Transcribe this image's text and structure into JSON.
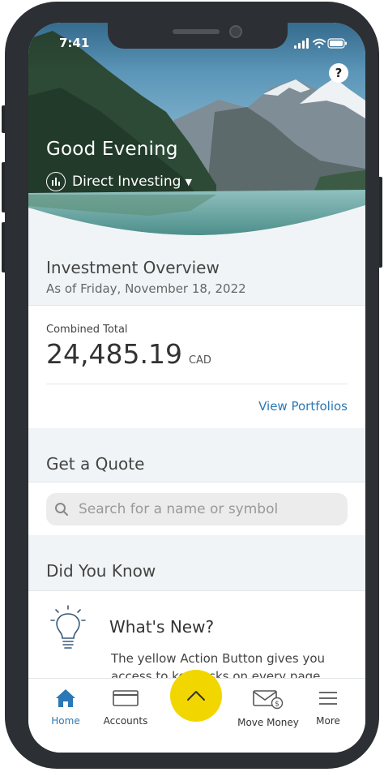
{
  "status_bar": {
    "time": "7:41"
  },
  "hero": {
    "greeting": "Good Evening",
    "account_selector": "Direct Investing",
    "help_icon": "question-icon"
  },
  "overview": {
    "title": "Investment Overview",
    "as_of": "As of Friday, November 18, 2022",
    "combined_label": "Combined Total",
    "amount": "24,485.19",
    "currency": "CAD",
    "view_link": "View Portfolios"
  },
  "quote": {
    "title": "Get a Quote",
    "search_placeholder": "Search for a name or symbol"
  },
  "did_you_know": {
    "title": "Did You Know",
    "card_title": "What's New?",
    "card_text": "The yellow Action Button gives you access to key tasks on every page."
  },
  "tabbar": {
    "items": [
      {
        "label": "Home",
        "icon": "home-icon",
        "active": true
      },
      {
        "label": "Accounts",
        "icon": "accounts-card-icon"
      },
      {
        "label": "Move Money",
        "icon": "envelope-dollar-icon"
      },
      {
        "label": "More",
        "icon": "hamburger-menu-icon"
      }
    ],
    "action_icon": "chevron-up-icon"
  },
  "colors": {
    "accent": "#2a78b5",
    "action": "#f2d600",
    "section_bg": "#f1f4f6"
  }
}
